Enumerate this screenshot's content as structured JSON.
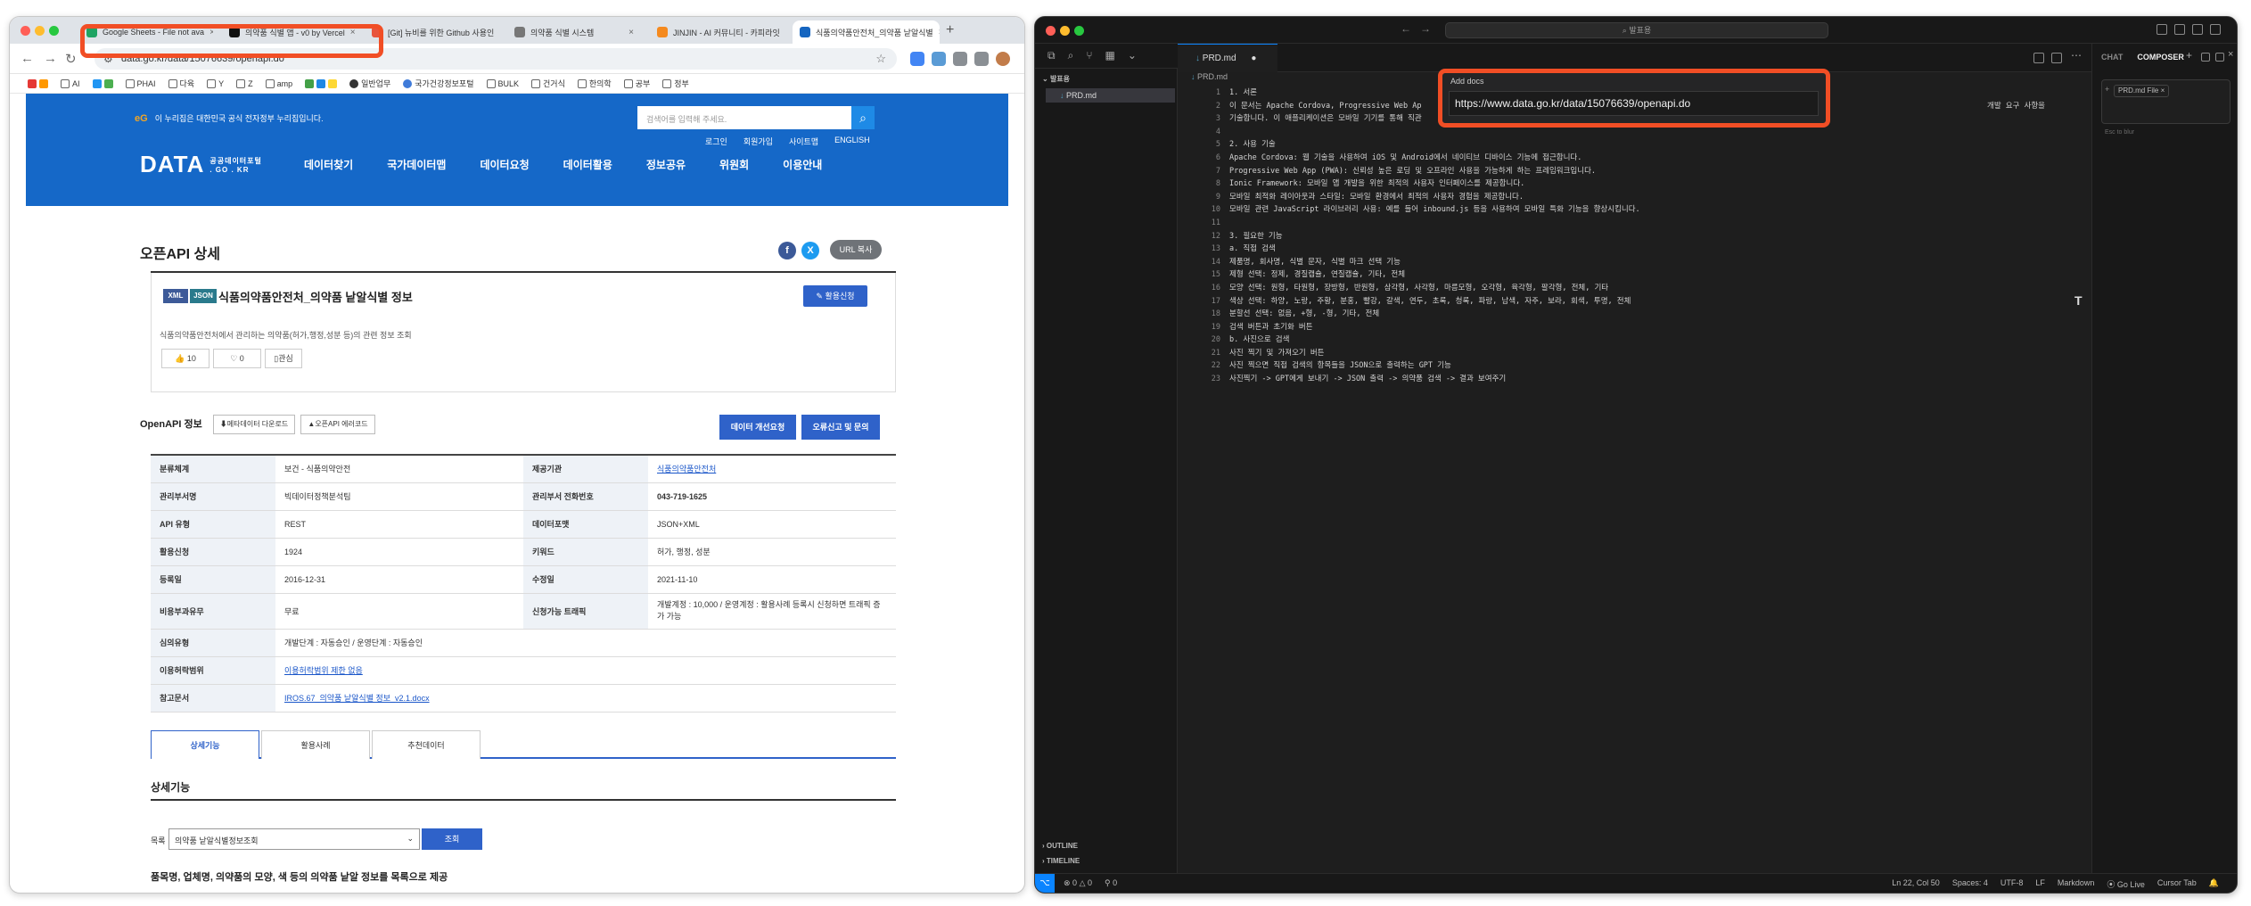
{
  "browser": {
    "tabs": [
      {
        "label": "Google Sheets - File not ava",
        "color": "#1fa463"
      },
      {
        "label": "의약품 식별 앱 - v0 by Vercel",
        "color": "#111111"
      },
      {
        "label": "[Git] 뉴비를 위한 Github 사용인",
        "color": "#e8543c"
      },
      {
        "label": "의약품 식별 시스템",
        "color": "#777777"
      },
      {
        "label": "JINJIN - AI 커뮤니티 - 카피라잇",
        "color": "#f58a1f"
      },
      {
        "label": "식품의약품안전처_의약품 낱알식별",
        "color": "#1565c0"
      }
    ],
    "url": "data.go.kr/data/15076639/openapi.do",
    "new_tab": "+",
    "bookmarks": [
      "AI",
      "PHAI",
      "다육",
      "Y",
      "Z",
      "amp",
      "BULK",
      "건거식",
      "한의학",
      "공부",
      "정부"
    ],
    "bookmark_misc": [
      "일반업무",
      "국가건강정보포털"
    ]
  },
  "site": {
    "gov_notice": "이 누리집은 대한민국 공식 전자정부 누리집입니다.",
    "eg_mark": "eG",
    "search_placeholder": "검색어를 입력해 주세요.",
    "util_links": [
      "로그인",
      "회원가입",
      "사이트맵",
      "ENGLISH"
    ],
    "logo": "DATA",
    "logo_sub1": "공공데이터포털",
    "logo_sub2": ". GO . KR",
    "nav": [
      "데이터찾기",
      "국가데이터맵",
      "데이터요청",
      "데이터활용",
      "정보공유",
      "위원회",
      "이용안내"
    ],
    "page_title": "오픈API 상세",
    "url_copy": "URL 복사",
    "badges": [
      "XML",
      "JSON"
    ],
    "dataset_name": "식품의약품안전처_의약품 낱알식별 정보",
    "apply_btn": "활용신청",
    "description": "식품의약품안전처에서 관리하는 의약품(허가,행정,성분 등)의 관련 정보 조회",
    "like_count": "10",
    "comment_count": "0",
    "interest": "관심",
    "openapi_info": "OpenAPI 정보",
    "metadata_dl": "메타데이터 다운로드",
    "error_report": "오픈API 에러코드",
    "improve_req": "데이터 개선요청",
    "report_btn": "오류신고 및 문의",
    "table": [
      [
        "분류체계",
        "보건 - 식품의약안전",
        "제공기관",
        "식품의약품안전처"
      ],
      [
        "관리부서명",
        "빅데이터정책분석팀",
        "관리부서 전화번호",
        "043-719-1625"
      ],
      [
        "API 유형",
        "REST",
        "데이터포맷",
        "JSON+XML"
      ],
      [
        "활용신청",
        "1924",
        "키워드",
        "허가, 행정, 성분"
      ],
      [
        "등록일",
        "2016-12-31",
        "수정일",
        "2021-11-10"
      ],
      [
        "비용부과유무",
        "무료",
        "신청가능 트래픽",
        "개발계정 : 10,000 / 운영계정 : 활용사례 등록시 신청하면 트래픽 증가 가능"
      ]
    ],
    "review_type_label": "심의유형",
    "review_type_value": "개발단계 : 자동승인 / 운영단계 : 자동승인",
    "usage_scope_label": "이용허락범위",
    "usage_scope_value": "이용허락범위 제한 없음",
    "ref_doc_label": "참고문서",
    "ref_doc_value": "IROS.67_의약품 낱알식별 정보_v2.1.docx",
    "subtabs": [
      "상세기능",
      "활용사례",
      "추천데이터"
    ],
    "detail_heading": "상세기능",
    "list_label": "목록",
    "select_value": "의약품 낱알식별정보조회",
    "query_btn": "조회",
    "bottom_text": "품목명, 업체명, 의약품의 모양, 색 등의 의약품 낱알 정보를 목록으로 제공"
  },
  "editor": {
    "search": "발표용",
    "sidebar_header": "발표용",
    "file": "PRD.md",
    "tab": "PRD.md",
    "breadcrumb": "PRD.md",
    "add_docs_label": "Add docs",
    "add_docs_value": "https://www.data.go.kr/data/15076639/openapi.do",
    "panel_tabs": [
      "CHAT",
      "COMPOSER"
    ],
    "panel_chip": "PRD.md File",
    "panel_hint": "Esc to blur",
    "outline": "OUTLINE",
    "timeline": "TIMELINE",
    "lines": [
      "1. 서론",
      "이 문서는 Apache Cordova, Progressive Web Ap",
      "기술합니다. 이 애플리케이션은 모바일 기기를 통해 직관",
      "",
      "2. 사용 기술",
      "Apache Cordova: 웹 기술을 사용하여 iOS 및 Android에서 네이티브 디바이스 기능에 접근합니다.",
      "Progressive Web App (PWA): 신뢰성 높은 로딩 및 오프라인 사용을 가능하게 하는 프레임워크입니다.",
      "Ionic Framework: 모바일 앱 개발을 위한 최적의 사용자 인터페이스를 제공합니다.",
      "모바일 최적화 레이아웃과 스타일: 모바일 환경에서 최적의 사용자 경험을 제공합니다.",
      "모바일 관련 JavaScript 라이브러리 사용: 예를 들어 inbound.js 등을 사용하여 모바일 특화 기능을 향상시킵니다.",
      "",
      "3. 필요한 기능",
      "a. 직접 검색",
      "제품명, 회사명, 식별 문자, 식별 마크 선택 기능",
      "제형 선택: 정제, 경질캡슐, 연질캡슐, 기타, 전체",
      "모양 선택: 원형, 타원형, 장방형, 반원형, 삼각형, 사각형, 마름모형, 오각형, 육각형, 팔각형, 전체, 기타",
      "색상 선택: 하양, 노랑, 주황, 분홍, 빨강, 갈색, 연두, 초록, 청록, 파랑, 남색, 자주, 보라, 회색, 투명, 전체",
      "분할선 선택: 없음, +형, -형, 기타, 전체",
      "검색 버튼과 초기화 버튼",
      "b. 사진으로 검색",
      "사진 찍기 및 가져오기 버튼",
      "사진 찍으면 직접 검색의 항목들을 JSON으로 출력하는 GPT 기능",
      "사진찍기 -> GPT에게 보내기 -> JSON 출력 -> 의약품 검색 -> 결과 보여주기"
    ],
    "line2_tail": "개발 요구 사항을",
    "status_left": [
      "0",
      "0",
      "0"
    ],
    "status_right": [
      "Ln 22, Col 50",
      "Spaces: 4",
      "UTF-8",
      "LF",
      "Markdown",
      "Go Live",
      "Cursor Tab"
    ]
  }
}
